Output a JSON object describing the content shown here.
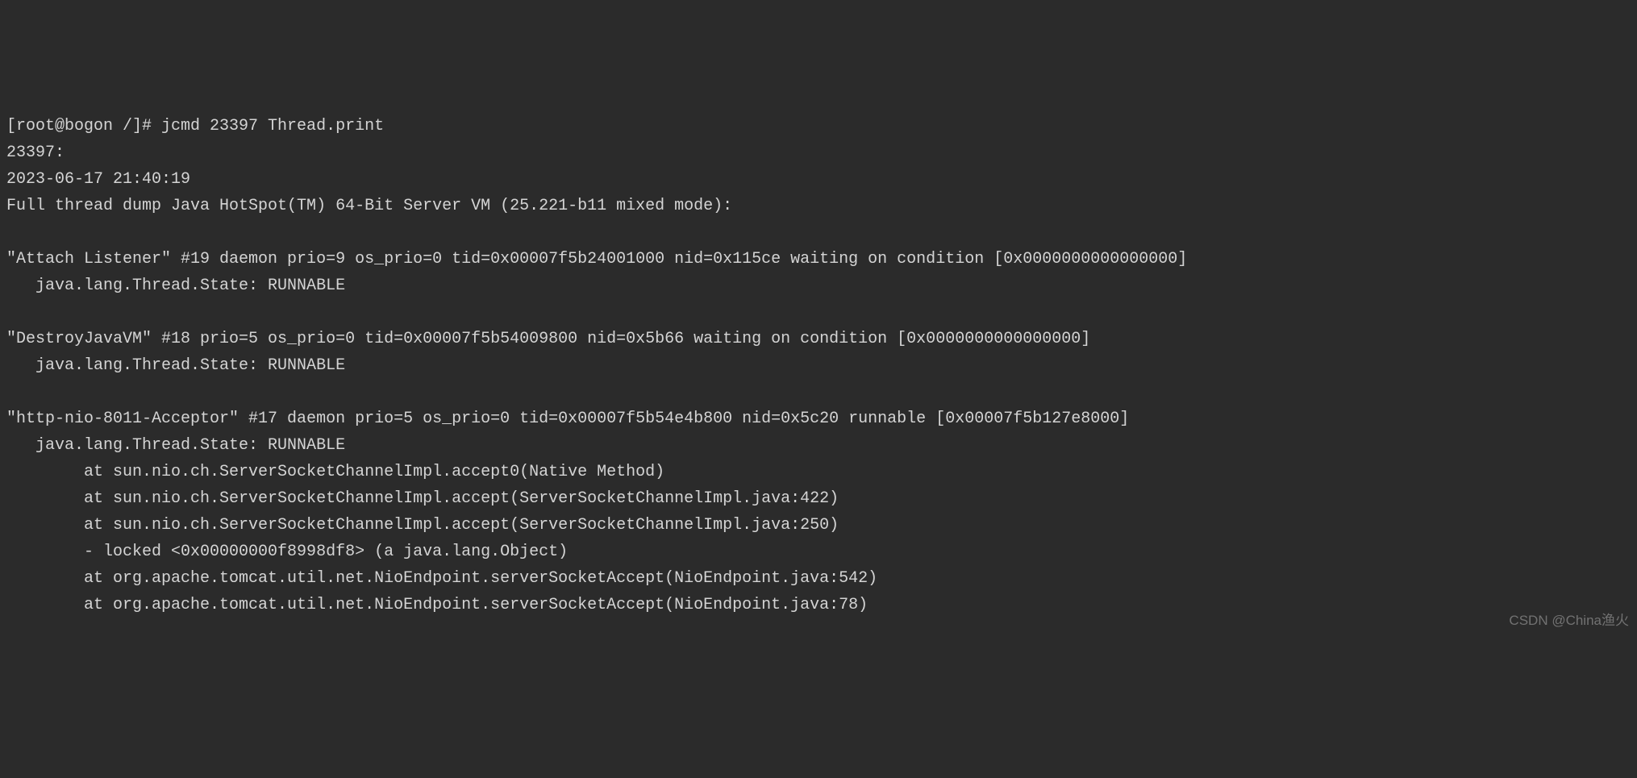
{
  "terminal": {
    "lines": [
      "[root@bogon /]# jcmd 23397 Thread.print",
      "23397:",
      "2023-06-17 21:40:19",
      "Full thread dump Java HotSpot(TM) 64-Bit Server VM (25.221-b11 mixed mode):",
      "",
      "\"Attach Listener\" #19 daemon prio=9 os_prio=0 tid=0x00007f5b24001000 nid=0x115ce waiting on condition [0x0000000000000000]",
      "   java.lang.Thread.State: RUNNABLE",
      "",
      "\"DestroyJavaVM\" #18 prio=5 os_prio=0 tid=0x00007f5b54009800 nid=0x5b66 waiting on condition [0x0000000000000000]",
      "   java.lang.Thread.State: RUNNABLE",
      "",
      "\"http-nio-8011-Acceptor\" #17 daemon prio=5 os_prio=0 tid=0x00007f5b54e4b800 nid=0x5c20 runnable [0x00007f5b127e8000]",
      "   java.lang.Thread.State: RUNNABLE",
      "        at sun.nio.ch.ServerSocketChannelImpl.accept0(Native Method)",
      "        at sun.nio.ch.ServerSocketChannelImpl.accept(ServerSocketChannelImpl.java:422)",
      "        at sun.nio.ch.ServerSocketChannelImpl.accept(ServerSocketChannelImpl.java:250)",
      "        - locked <0x00000000f8998df8> (a java.lang.Object)",
      "        at org.apache.tomcat.util.net.NioEndpoint.serverSocketAccept(NioEndpoint.java:542)",
      "        at org.apache.tomcat.util.net.NioEndpoint.serverSocketAccept(NioEndpoint.java:78)"
    ]
  },
  "watermark": "CSDN @China渔火"
}
